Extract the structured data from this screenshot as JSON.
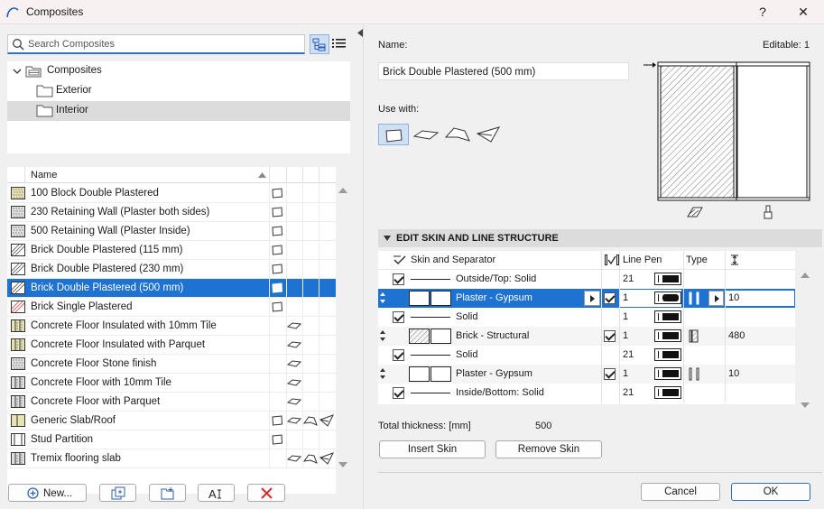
{
  "window": {
    "title": "Composites",
    "help_label": "?",
    "close_label": "✕"
  },
  "search": {
    "placeholder": "Search Composites"
  },
  "tree": {
    "root": "Composites",
    "children": [
      "Exterior",
      "Interior"
    ],
    "selected": "Interior"
  },
  "list": {
    "column_name": "Name",
    "items": [
      {
        "name": "100 Block Double Plastered",
        "swatch": "#e8e3b4",
        "pattern": "dots",
        "uses": [
          "wall"
        ]
      },
      {
        "name": "230 Retaining Wall (Plaster both sides)",
        "swatch": "#e0e0e0",
        "pattern": "stipple",
        "uses": [
          "wall"
        ]
      },
      {
        "name": "500 Retaining Wall (Plaster Inside)",
        "swatch": "#e0e0e0",
        "pattern": "stipple",
        "uses": [
          "wall"
        ]
      },
      {
        "name": "Brick Double Plastered (115 mm)",
        "swatch": "#ffffff",
        "pattern": "hatch",
        "uses": [
          "wall"
        ]
      },
      {
        "name": "Brick Double Plastered (230 mm)",
        "swatch": "#ffffff",
        "pattern": "hatch",
        "uses": [
          "wall"
        ]
      },
      {
        "name": "Brick Double Plastered (500 mm)",
        "swatch": "#ffffff",
        "pattern": "hatch",
        "uses": [
          "wall"
        ]
      },
      {
        "name": "Brick Single Plastered",
        "swatch": "#ffffff",
        "pattern": "hatch-red",
        "uses": [
          "wall"
        ]
      },
      {
        "name": "Concrete Floor Insulated with 10mm Tile",
        "swatch": "#e8e3b4",
        "pattern": "layered",
        "uses": [
          "slab"
        ]
      },
      {
        "name": "Concrete Floor Insulated with Parquet",
        "swatch": "#e8e3b4",
        "pattern": "layered",
        "uses": [
          "slab"
        ]
      },
      {
        "name": "Concrete Floor Stone finish",
        "swatch": "#e0e0e0",
        "pattern": "stipple",
        "uses": [
          "slab"
        ]
      },
      {
        "name": "Concrete Floor with 10mm Tile",
        "swatch": "#e0e0e0",
        "pattern": "layered",
        "uses": [
          "slab"
        ]
      },
      {
        "name": "Concrete Floor with Parquet",
        "swatch": "#e0e0e0",
        "pattern": "layered",
        "uses": [
          "slab"
        ]
      },
      {
        "name": "Generic Slab/Roof",
        "swatch": "#e8e3b4",
        "pattern": "split",
        "uses": [
          "wall",
          "slab",
          "roof",
          "shell"
        ]
      },
      {
        "name": "Stud Partition",
        "swatch": "#ffffff",
        "pattern": "stud",
        "uses": [
          "wall"
        ]
      },
      {
        "name": "Tremix flooring slab",
        "swatch": "#e0e0e0",
        "pattern": "layered",
        "uses": [
          "slab",
          "roof",
          "shell"
        ]
      }
    ],
    "selected_index": 5
  },
  "bottom_buttons": {
    "new_label": "New...",
    "new_icon": "plus-circle-icon"
  },
  "detail": {
    "name_label": "Name:",
    "name_value": "Brick Double Plastered (500 mm)",
    "editable_label": "Editable: 1",
    "use_with_label": "Use with:",
    "section_title": "EDIT SKIN AND LINE STRUCTURE",
    "columns": {
      "skin": "Skin and Separator",
      "line_pen": "Line Pen",
      "type": "Type"
    },
    "rows": [
      {
        "kind": "line",
        "check": true,
        "label": "Outside/Top: Solid",
        "pen": "21",
        "value": ""
      },
      {
        "kind": "skin",
        "label": "Plaster - Gypsum",
        "pen": "1",
        "value": "10",
        "selected": true,
        "fill": "#ffffff"
      },
      {
        "kind": "line",
        "check": true,
        "label": "Solid",
        "pen": "1",
        "value": ""
      },
      {
        "kind": "skin",
        "label": "Brick - Structural",
        "pen": "1",
        "value": "480",
        "fill": "hatch"
      },
      {
        "kind": "line",
        "check": true,
        "label": "Solid",
        "pen": "21",
        "value": ""
      },
      {
        "kind": "skin",
        "label": "Plaster - Gypsum",
        "pen": "1",
        "value": "10",
        "fill": "#ffffff"
      },
      {
        "kind": "line",
        "check": true,
        "label": "Inside/Bottom: Solid",
        "pen": "21",
        "value": ""
      }
    ],
    "total_label": "Total thickness: [mm]",
    "total_value": "500",
    "insert_skin_label": "Insert Skin",
    "remove_skin_label": "Remove Skin",
    "cancel_label": "Cancel",
    "ok_label": "OK"
  }
}
